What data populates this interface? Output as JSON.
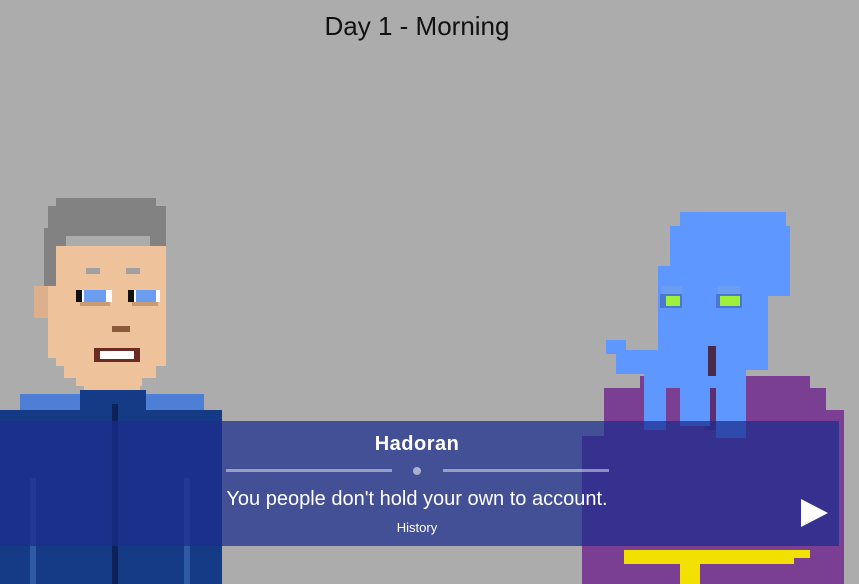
{
  "scene": {
    "day_title": "Day 1 - Morning"
  },
  "characters": {
    "left_portrait_icon": "human-officer-portrait",
    "right_portrait_icon": "blue-tentacled-alien-portrait"
  },
  "dialogue": {
    "speaker": "Hadoran",
    "line": "You people don't hold your own to account.",
    "history_label": "History",
    "next_icon": "play-triangle-icon"
  },
  "colors": {
    "background": "#acacac",
    "dialogue_box": "#1c2d8c",
    "text": "#ffffff"
  }
}
